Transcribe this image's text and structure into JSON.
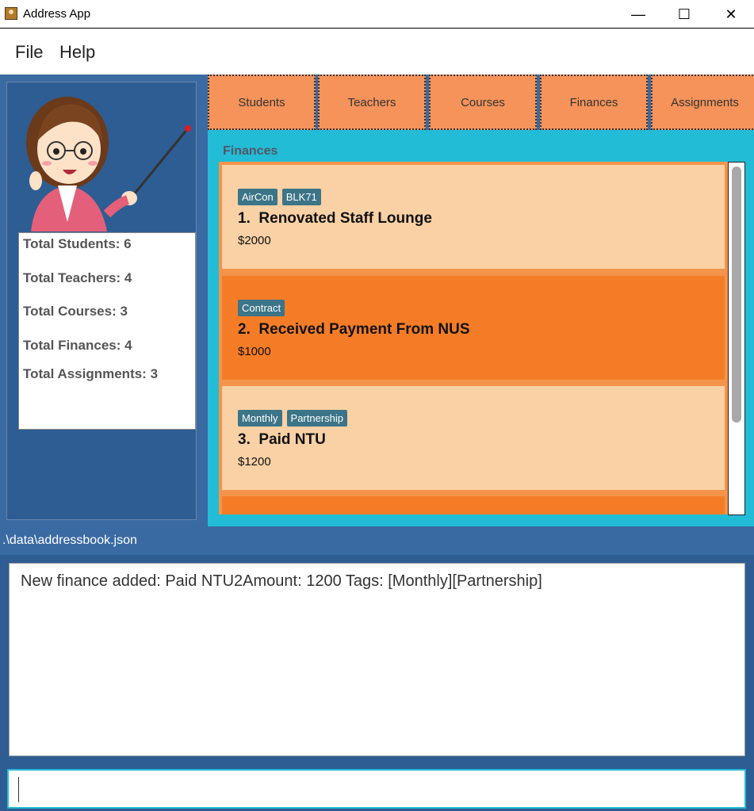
{
  "window": {
    "title": "Address App",
    "controls": {
      "minimize": "—",
      "maximize": "☐",
      "close": "✕"
    }
  },
  "menu": {
    "items": [
      "File",
      "Help"
    ]
  },
  "icons": {
    "app": "address-book-icon",
    "mascot": "teacher-pointer-illustration"
  },
  "stats": {
    "students": "Total Students: 6",
    "teachers": "Total Teachers: 4",
    "courses": "Total Courses: 3",
    "finances": "Total Finances: 4",
    "assignments": "Total Assignments: 3"
  },
  "tabs": [
    "Students",
    "Teachers",
    "Courses",
    "Finances",
    "Assignments"
  ],
  "panel": {
    "title": "Finances",
    "cards": [
      {
        "tags": [
          "AirCon",
          "BLK71"
        ],
        "title": "1.  Renovated Staff Lounge",
        "amount": "$2000"
      },
      {
        "tags": [
          "Contract"
        ],
        "title": "2.  Received Payment From NUS",
        "amount": "$1000"
      },
      {
        "tags": [
          "Monthly",
          "Partnership"
        ],
        "title": "3.  Paid NTU",
        "amount": "$1200"
      }
    ]
  },
  "status": {
    "file_path": ".\\data\\addressbook.json"
  },
  "result": {
    "message": "New finance added: Paid NTU2Amount: 1200 Tags: [Monthly][Partnership]"
  },
  "command": {
    "value": "",
    "placeholder": ""
  },
  "colors": {
    "tab": "#f5935a",
    "card_light": "#f9d1a5",
    "card_dark": "#f57c27",
    "panel": "#22bcd6",
    "sidebar": "#2e5d93",
    "tag": "#3c7488"
  }
}
